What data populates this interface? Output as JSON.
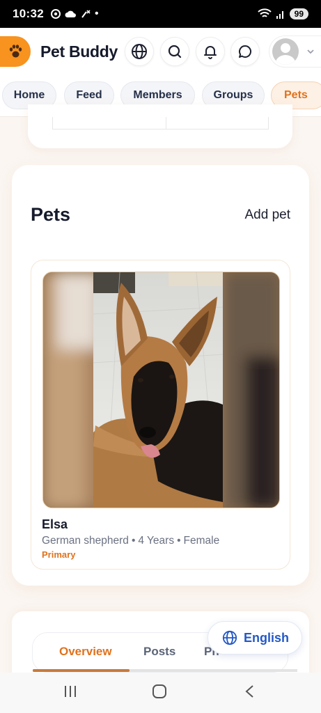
{
  "status_bar": {
    "time": "10:32",
    "battery": "99"
  },
  "header": {
    "brand": "Pet Buddy",
    "icons": [
      "paw-icon",
      "globe-icon",
      "search-icon",
      "bell-icon",
      "chat-icon",
      "avatar",
      "chevron-down-icon"
    ]
  },
  "nav": {
    "items": [
      {
        "label": "Home"
      },
      {
        "label": "Feed"
      },
      {
        "label": "Members"
      },
      {
        "label": "Groups"
      },
      {
        "label": "Pets",
        "active": true
      }
    ]
  },
  "pets_section": {
    "title": "Pets",
    "add_label": "Add pet",
    "pets": [
      {
        "name": "Elsa",
        "breed": "German shepherd",
        "age": "4 Years",
        "sex": "Female",
        "badge": "Primary"
      }
    ]
  },
  "profile_tabs": {
    "tabs": [
      {
        "label": "Overview",
        "active": true
      },
      {
        "label": "Posts"
      },
      {
        "label": "Ph"
      }
    ]
  },
  "language_button": {
    "label": "English"
  },
  "colors": {
    "accent": "#e0721d",
    "link": "#2458c6",
    "text": "#161b2c"
  }
}
